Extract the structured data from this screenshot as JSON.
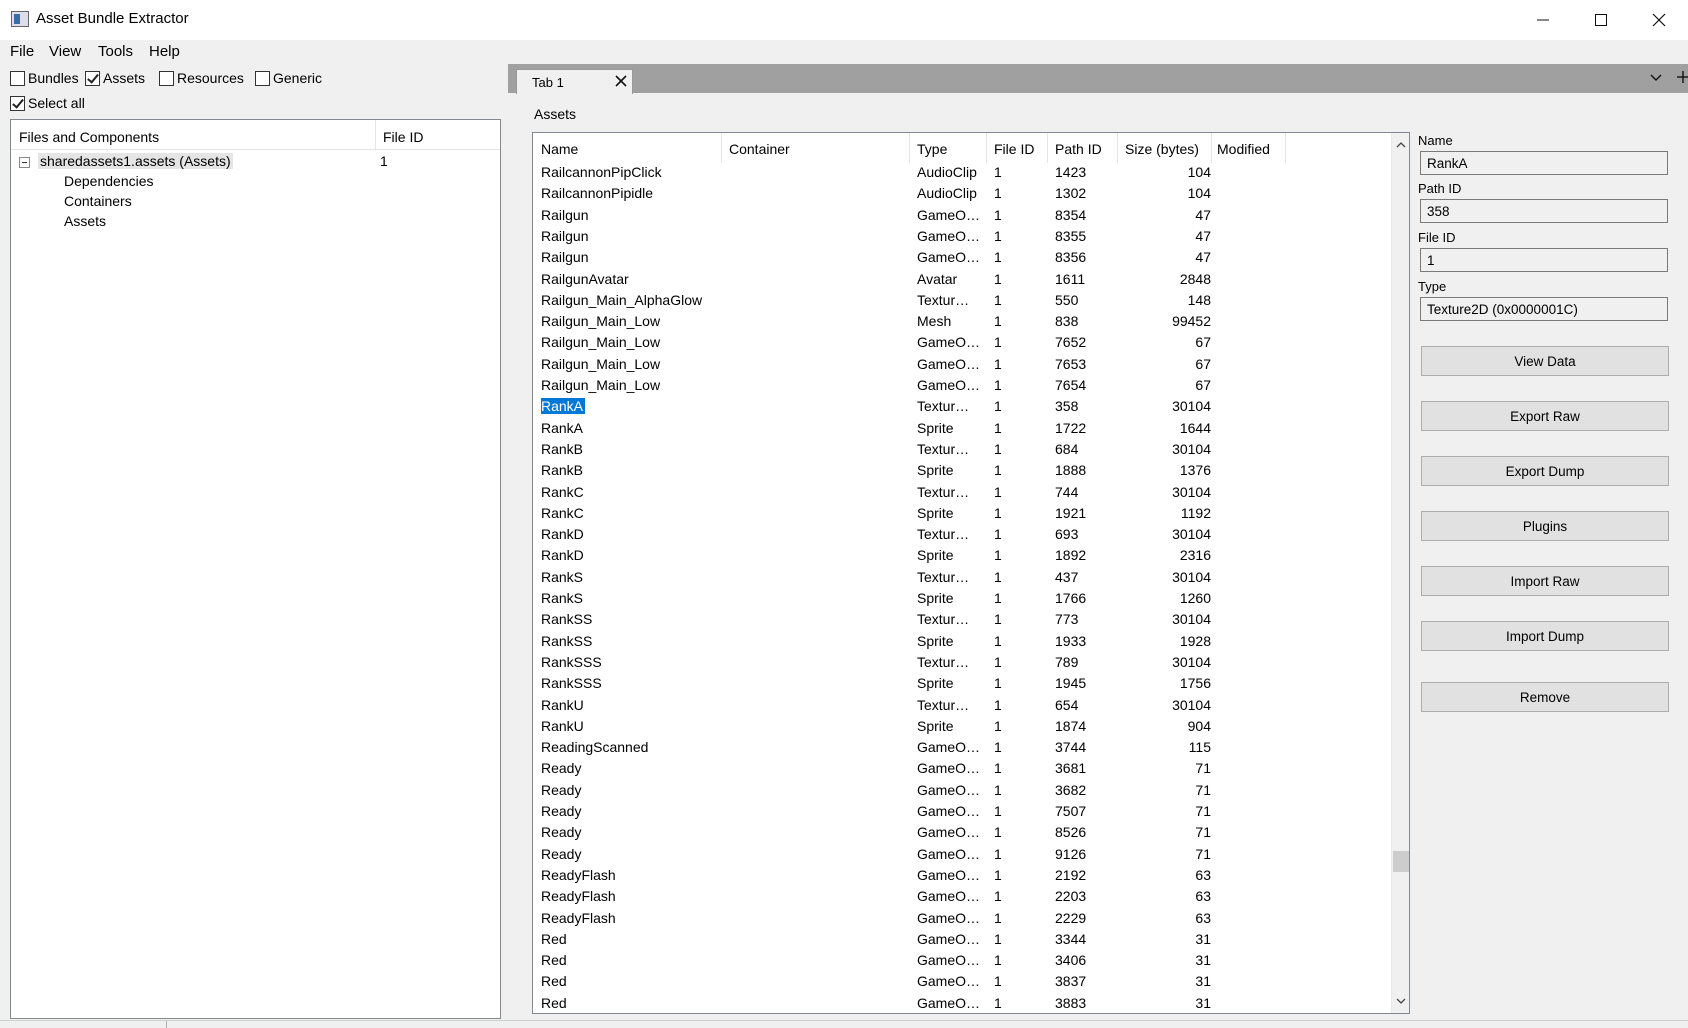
{
  "window": {
    "title": "Asset Bundle Extractor"
  },
  "menu": [
    "File",
    "View",
    "Tools",
    "Help"
  ],
  "filters": {
    "bundles": {
      "label": "Bundles",
      "checked": false
    },
    "assets": {
      "label": "Assets",
      "checked": true
    },
    "resources": {
      "label": "Resources",
      "checked": false
    },
    "generic": {
      "label": "Generic",
      "checked": false
    },
    "select_all": {
      "label": "Select all",
      "checked": true
    }
  },
  "tree": {
    "col_files": "Files and Components",
    "col_file_id": "File ID",
    "root": {
      "label": "sharedassets1.assets (Assets)",
      "file_id": "1"
    },
    "children": [
      "Dependencies",
      "Containers",
      "Assets"
    ]
  },
  "tabs": [
    {
      "label": "Tab 1"
    }
  ],
  "assets_panel": {
    "caption": "Assets",
    "columns": [
      "Name",
      "Container",
      "Type",
      "File ID",
      "Path ID",
      "Size (bytes)",
      "Modified"
    ],
    "rows": [
      [
        "RailcannonPipClick",
        "",
        "AudioClip",
        "1",
        "1423",
        "104"
      ],
      [
        "RailcannonPipidle",
        "",
        "AudioClip",
        "1",
        "1302",
        "104"
      ],
      [
        "Railgun",
        "",
        "GameO…",
        "1",
        "8354",
        "47"
      ],
      [
        "Railgun",
        "",
        "GameO…",
        "1",
        "8355",
        "47"
      ],
      [
        "Railgun",
        "",
        "GameO…",
        "1",
        "8356",
        "47"
      ],
      [
        "RailgunAvatar",
        "",
        "Avatar",
        "1",
        "1611",
        "2848"
      ],
      [
        "Railgun_Main_AlphaGlow",
        "",
        "Textur…",
        "1",
        "550",
        "148"
      ],
      [
        "Railgun_Main_Low",
        "",
        "Mesh",
        "1",
        "838",
        "99452"
      ],
      [
        "Railgun_Main_Low",
        "",
        "GameO…",
        "1",
        "7652",
        "67"
      ],
      [
        "Railgun_Main_Low",
        "",
        "GameO…",
        "1",
        "7653",
        "67"
      ],
      [
        "Railgun_Main_Low",
        "",
        "GameO…",
        "1",
        "7654",
        "67"
      ],
      [
        "RankA",
        "",
        "Textur…",
        "1",
        "358",
        "30104"
      ],
      [
        "RankA",
        "",
        "Sprite",
        "1",
        "1722",
        "1644"
      ],
      [
        "RankB",
        "",
        "Textur…",
        "1",
        "684",
        "30104"
      ],
      [
        "RankB",
        "",
        "Sprite",
        "1",
        "1888",
        "1376"
      ],
      [
        "RankC",
        "",
        "Textur…",
        "1",
        "744",
        "30104"
      ],
      [
        "RankC",
        "",
        "Sprite",
        "1",
        "1921",
        "1192"
      ],
      [
        "RankD",
        "",
        "Textur…",
        "1",
        "693",
        "30104"
      ],
      [
        "RankD",
        "",
        "Sprite",
        "1",
        "1892",
        "2316"
      ],
      [
        "RankS",
        "",
        "Textur…",
        "1",
        "437",
        "30104"
      ],
      [
        "RankS",
        "",
        "Sprite",
        "1",
        "1766",
        "1260"
      ],
      [
        "RankSS",
        "",
        "Textur…",
        "1",
        "773",
        "30104"
      ],
      [
        "RankSS",
        "",
        "Sprite",
        "1",
        "1933",
        "1928"
      ],
      [
        "RankSSS",
        "",
        "Textur…",
        "1",
        "789",
        "30104"
      ],
      [
        "RankSSS",
        "",
        "Sprite",
        "1",
        "1945",
        "1756"
      ],
      [
        "RankU",
        "",
        "Textur…",
        "1",
        "654",
        "30104"
      ],
      [
        "RankU",
        "",
        "Sprite",
        "1",
        "1874",
        "904"
      ],
      [
        "ReadingScanned",
        "",
        "GameO…",
        "1",
        "3744",
        "115"
      ],
      [
        "Ready",
        "",
        "GameO…",
        "1",
        "3681",
        "71"
      ],
      [
        "Ready",
        "",
        "GameO…",
        "1",
        "3682",
        "71"
      ],
      [
        "Ready",
        "",
        "GameO…",
        "1",
        "7507",
        "71"
      ],
      [
        "Ready",
        "",
        "GameO…",
        "1",
        "8526",
        "71"
      ],
      [
        "Ready",
        "",
        "GameO…",
        "1",
        "9126",
        "71"
      ],
      [
        "ReadyFlash",
        "",
        "GameO…",
        "1",
        "2192",
        "63"
      ],
      [
        "ReadyFlash",
        "",
        "GameO…",
        "1",
        "2203",
        "63"
      ],
      [
        "ReadyFlash",
        "",
        "GameO…",
        "1",
        "2229",
        "63"
      ],
      [
        "Red",
        "",
        "GameO…",
        "1",
        "3344",
        "31"
      ],
      [
        "Red",
        "",
        "GameO…",
        "1",
        "3406",
        "31"
      ],
      [
        "Red",
        "",
        "GameO…",
        "1",
        "3837",
        "31"
      ],
      [
        "Red",
        "",
        "GameO…",
        "1",
        "3883",
        "31"
      ]
    ],
    "selected_row": 11
  },
  "properties": {
    "name_label": "Name",
    "name_value": "RankA",
    "path_id_label": "Path ID",
    "path_id_value": "358",
    "file_id_label": "File ID",
    "file_id_value": "1",
    "type_label": "Type",
    "type_value": "Texture2D (0x0000001C)"
  },
  "actions": {
    "view_data": "View Data",
    "export_raw": "Export Raw",
    "export_dump": "Export Dump",
    "plugins": "Plugins",
    "import_raw": "Import Raw",
    "import_dump": "Import Dump",
    "remove": "Remove"
  },
  "colors": {
    "selection": "#0078d7",
    "tab_strip": "#a0a0a0"
  }
}
